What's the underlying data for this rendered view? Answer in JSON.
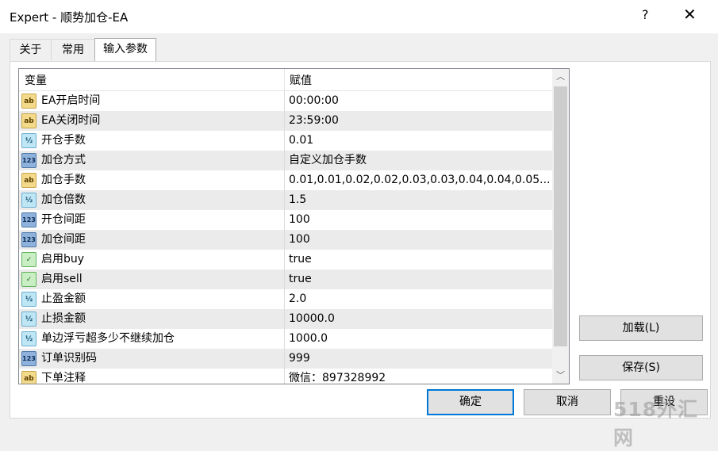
{
  "window": {
    "title": "Expert - 顺势加仓-EA",
    "help_glyph": "?",
    "close_glyph": "✕"
  },
  "tabs": [
    {
      "label": "关于",
      "active": false
    },
    {
      "label": "常用",
      "active": false
    },
    {
      "label": "输入参数",
      "active": true
    }
  ],
  "grid": {
    "columns": {
      "variable": "变量",
      "value": "赋值"
    },
    "rows": [
      {
        "icon": "string-icon",
        "icon_text": "ab",
        "name": "EA开启时间",
        "value": "00:00:00"
      },
      {
        "icon": "string-icon",
        "icon_text": "ab",
        "name": "EA关闭时间",
        "value": "23:59:00"
      },
      {
        "icon": "double-icon",
        "icon_text": "½",
        "name": "开仓手数",
        "value": "0.01"
      },
      {
        "icon": "integer-icon",
        "icon_text": "123",
        "name": "加仓方式",
        "value": "自定义加仓手数"
      },
      {
        "icon": "string-icon",
        "icon_text": "ab",
        "name": "加仓手数",
        "value": "0.01,0.01,0.02,0.02,0.03,0.03,0.04,0.04,0.05..."
      },
      {
        "icon": "double-icon",
        "icon_text": "½",
        "name": "加仓倍数",
        "value": "1.5"
      },
      {
        "icon": "integer-icon",
        "icon_text": "123",
        "name": "开仓间距",
        "value": "100"
      },
      {
        "icon": "integer-icon",
        "icon_text": "123",
        "name": "加仓间距",
        "value": "100"
      },
      {
        "icon": "bool-icon",
        "icon_text": "✓",
        "name": "启用buy",
        "value": "true"
      },
      {
        "icon": "bool-icon",
        "icon_text": "✓",
        "name": "启用sell",
        "value": "true"
      },
      {
        "icon": "double-icon",
        "icon_text": "½",
        "name": "止盈金额",
        "value": "2.0"
      },
      {
        "icon": "double-icon",
        "icon_text": "½",
        "name": "止损金额",
        "value": "10000.0"
      },
      {
        "icon": "double-icon",
        "icon_text": "½",
        "name": "单边浮亏超多少不继续加仓",
        "value": "1000.0"
      },
      {
        "icon": "integer-icon",
        "icon_text": "123",
        "name": "订单识别码",
        "value": "999"
      },
      {
        "icon": "string-icon",
        "icon_text": "ab",
        "name": "下单注释",
        "value": "微信：897328992"
      }
    ]
  },
  "scrollbar": {
    "up_glyph": "︿",
    "down_glyph": "﹀"
  },
  "buttons": {
    "load": "加载(L)",
    "save": "保存(S)",
    "ok": "确定",
    "cancel": "取消",
    "reset": "重设"
  },
  "watermark": "518外汇网"
}
